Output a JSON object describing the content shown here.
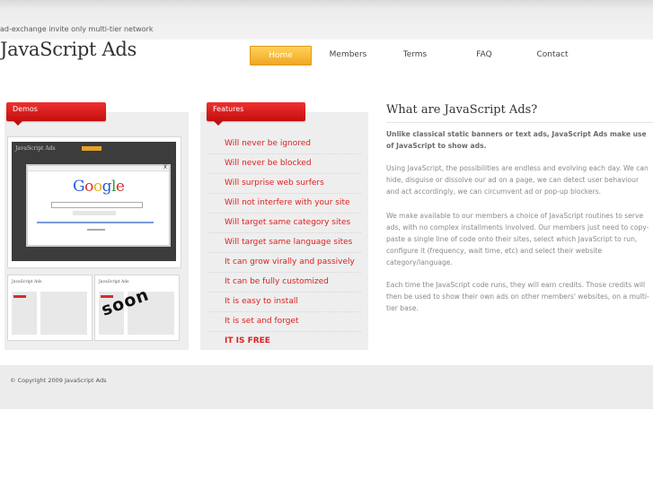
{
  "header": {
    "tagline": "ad-exchange invite only multi-tier network",
    "title": "JavaScript Ads"
  },
  "nav": {
    "items": [
      {
        "label": "Home",
        "active": true
      },
      {
        "label": "Members"
      },
      {
        "label": "Terms"
      },
      {
        "label": "FAQ"
      },
      {
        "label": "Contact"
      }
    ]
  },
  "demos": {
    "tab_label": "Demos",
    "screenshot": {
      "site_title": "JavaScript Ads",
      "logo_text": "Google",
      "close": "X"
    },
    "thumbs": [
      {
        "site_title": "JavaScript Ads"
      },
      {
        "site_title": "JavaScript Ads"
      }
    ],
    "coming_soon": "soon"
  },
  "features": {
    "tab_label": "Features",
    "items": [
      "Will never be ignored",
      "Will never be blocked",
      "Will surprise web surfers",
      "Will not interfere with your site",
      "Will target same category sites",
      "Will target same language sites",
      "It can grow virally and passively",
      "It can be fully customized",
      "It is easy to install",
      "It is set and forget",
      "IT IS FREE"
    ]
  },
  "article": {
    "title": "What are JavaScript Ads?",
    "paragraphs": [
      "Unlike classical static banners or text ads, JavaScript Ads make use of JavaScript to show ads.",
      "Using JavaScript, the possibilities are endless and evolving each day. We can hide, disguise or dissolve our ad on a page, we can detect user behaviour and act accordingly, we can circumvent ad or pop-up blockers.",
      "We make available to our members a choice of JavaScript routines to serve ads, with no complex installments involved. Our members just need to copy-paste a single line of code onto their sites, select which JavaScript to run, configure it (frequency, wait time, etc) and select their website category/language.",
      "Each time the JavaScript code runs, they will earn credits. Those credits will then be used to show their own ads on other members' websites, on a multi-tier base."
    ]
  },
  "footer": {
    "copyright": "© Copyright 2009 JavaScript Ads"
  },
  "colors": {
    "accent_red": "#dd1f1f",
    "nav_active": "#f0a623",
    "panel_bg": "#eeeeee"
  }
}
